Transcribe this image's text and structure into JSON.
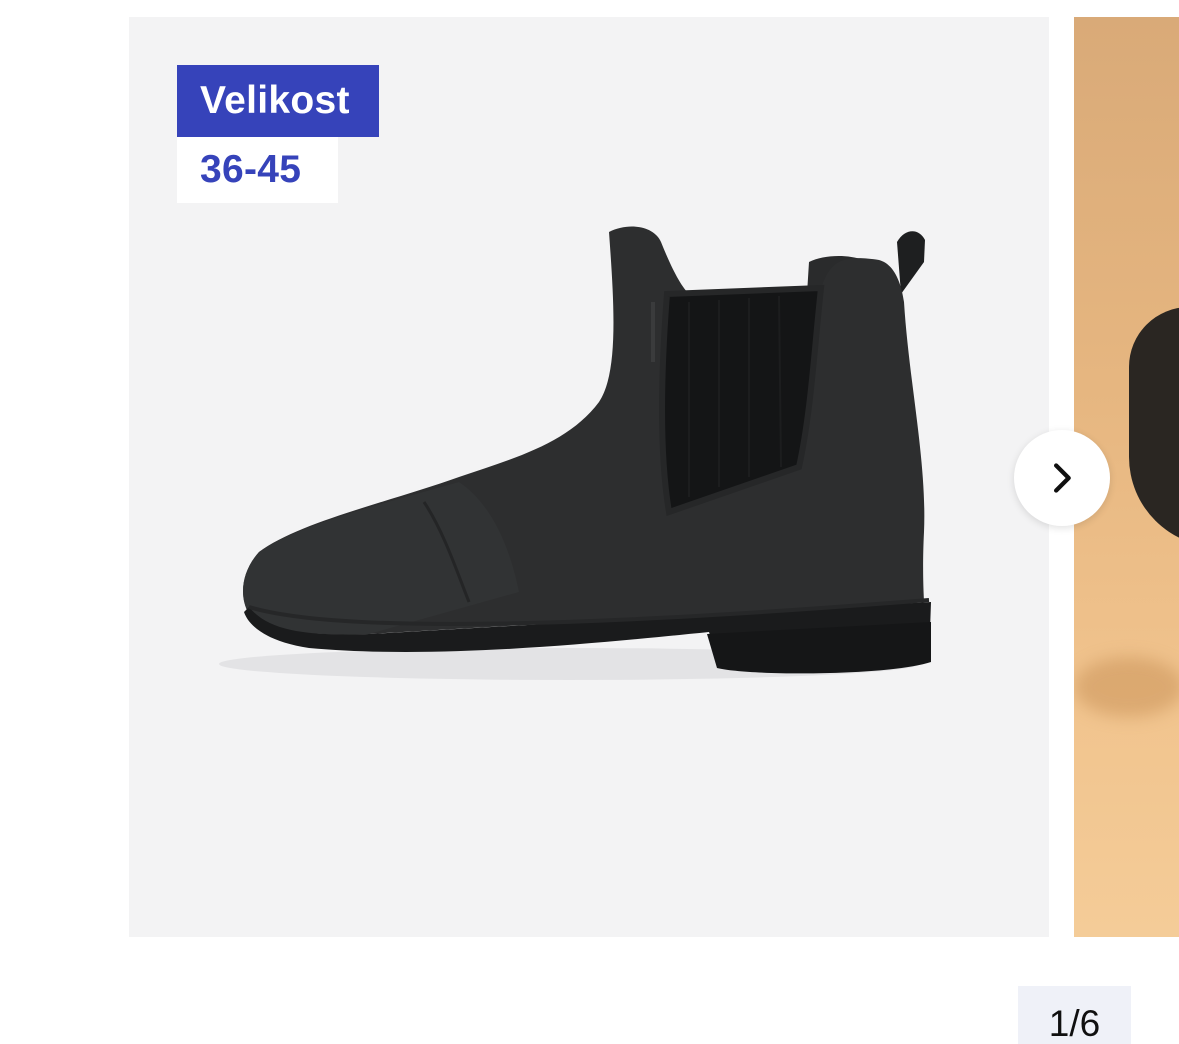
{
  "gallery": {
    "size_badge": {
      "label": "Velikost",
      "value": "36-45"
    },
    "current_slide": 1,
    "total_slides": 6,
    "counter_text": "1/6",
    "next_button_icon": "chevron-right-icon"
  },
  "colors": {
    "brand_blue": "#3643ba",
    "image_background": "#f3f3f4",
    "counter_background": "#eff1f8",
    "next_slide_background": "#e6b680"
  }
}
